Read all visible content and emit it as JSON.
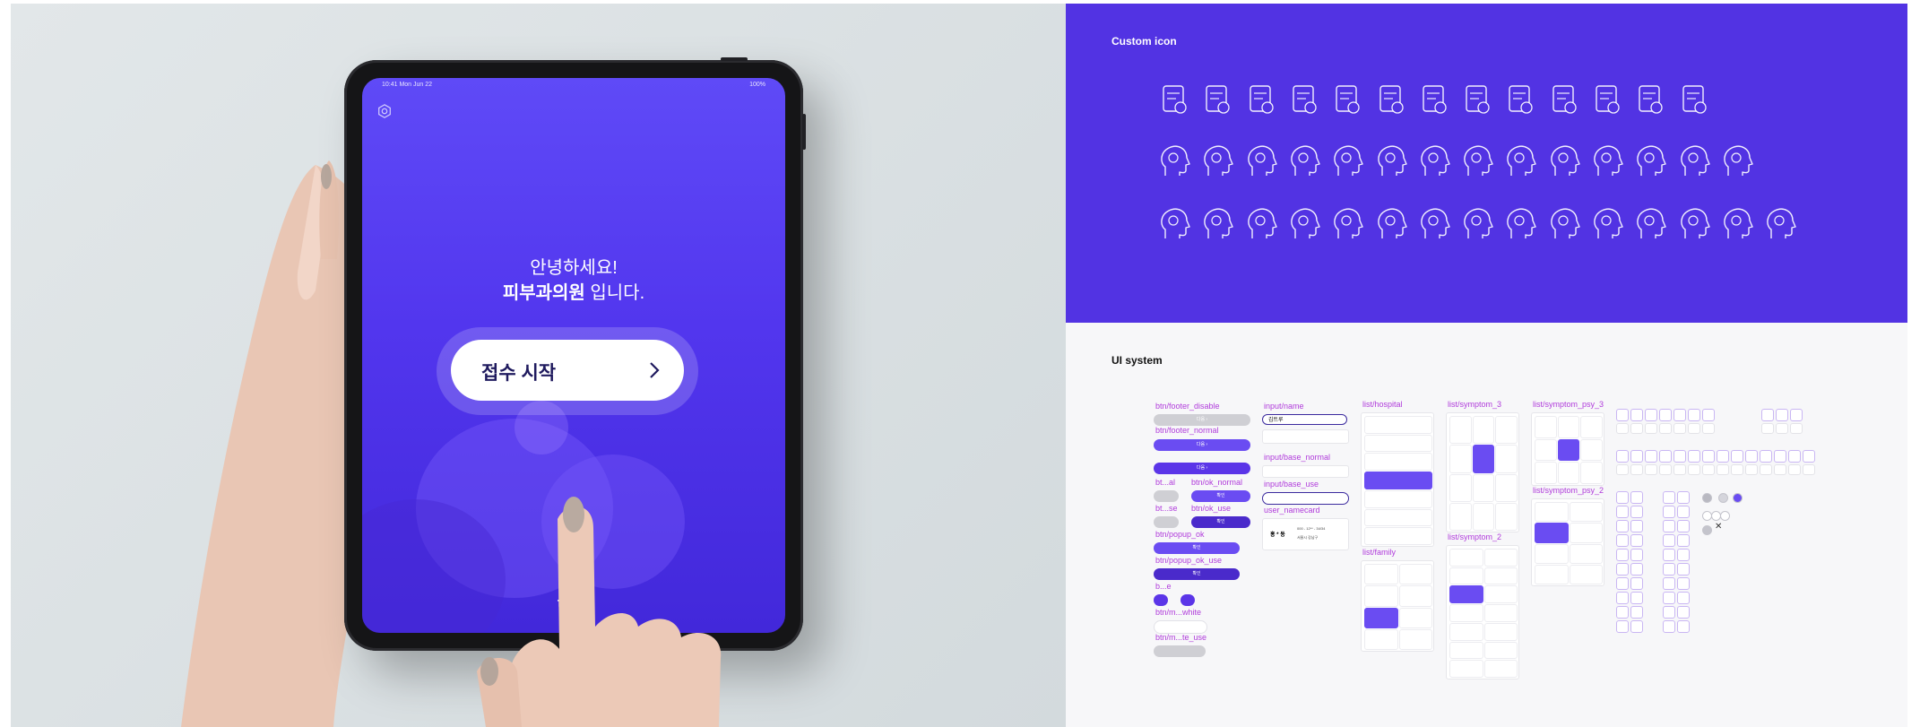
{
  "mockup": {
    "status_time": "10:41  Mon Jun 22",
    "status_right": "100%",
    "greeting_line1": "안녕하세요!",
    "greeting_bold": "피부과의원",
    "greeting_suffix": " 입니다.",
    "start_button": "접수 시작",
    "brand": "true"
  },
  "icon_panel": {
    "title": "Custom icon",
    "rows": [
      [
        "hospital-record-icon",
        "laptop-medical-icon",
        "virus-network-icon",
        "chat-document-icon",
        "medical-monitor-icon",
        "mobile-consult-icon",
        "more-dots-icon",
        "thermometer-icon",
        "syringe-icon",
        "document-icon",
        "doctor-icon",
        "group-doctors-icon",
        "nurse-icon"
      ],
      [
        "head-throat-icon",
        "head-profile-icon",
        "head-swirl-icon",
        "hand-head-icon",
        "head-face-icon",
        "nose-icon",
        "stomach-icon",
        "joint-icon",
        "body-back-icon",
        "face-icon",
        "arm-muscle-icon",
        "heart-pulse-icon",
        "hand-stop-icon",
        "stethoscope-icon"
      ],
      [
        "head-cloud-icon",
        "head-sleep-icon",
        "head-battery-icon",
        "head-adhd-icon",
        "head-lightning-icon",
        "head-forbid-icon",
        "head-spiral-icon",
        "head-brain-icon",
        "head-question-icon",
        "man-suit-icon",
        "woman-icon",
        "man-mask-icon",
        "man-beard-icon",
        "woman-curly-icon",
        "woman-long-hair-icon"
      ]
    ]
  },
  "ui_panel": {
    "title": "UI system",
    "labels": {
      "footer_disable": "btn/footer_disable",
      "footer_normal": "btn/footer_normal",
      "ok_normal": "btn/ok_normal",
      "ok_use": "btn/ok_use",
      "bt_al": "bt...al",
      "bt_se": "bt...se",
      "popup_ok": "btn/popup_ok",
      "popup_ok_use": "btn/popup_ok_use",
      "b_e": "b...e",
      "m_white": "btn/m...white",
      "m_use": "btn/m...te_use",
      "input_name": "input/name",
      "input_base_normal": "input/base_normal",
      "input_base_use": "input/base_use",
      "user_namecard": "user_namecard",
      "list_hospital": "list/hospital",
      "list_family": "list/family",
      "list_symptom_3": "list/symptom_3",
      "list_symptom_2": "list/symptom_2",
      "list_symptom_psy_3": "list/symptom_psy_3",
      "list_symptom_psy_2": "list/symptom_psy_2"
    },
    "button_text": {
      "next": "다음",
      "confirm": "확인"
    },
    "input_name_value": "김트루",
    "namecard_name": "홍 * 동",
    "namecard_line1": "000 - 12** - 34/34",
    "namecard_line2": "서울시 강남구"
  },
  "colors": {
    "accent": "#5233e3",
    "button_purple": "#5b35e8",
    "label_magenta": "#b03bdb"
  }
}
